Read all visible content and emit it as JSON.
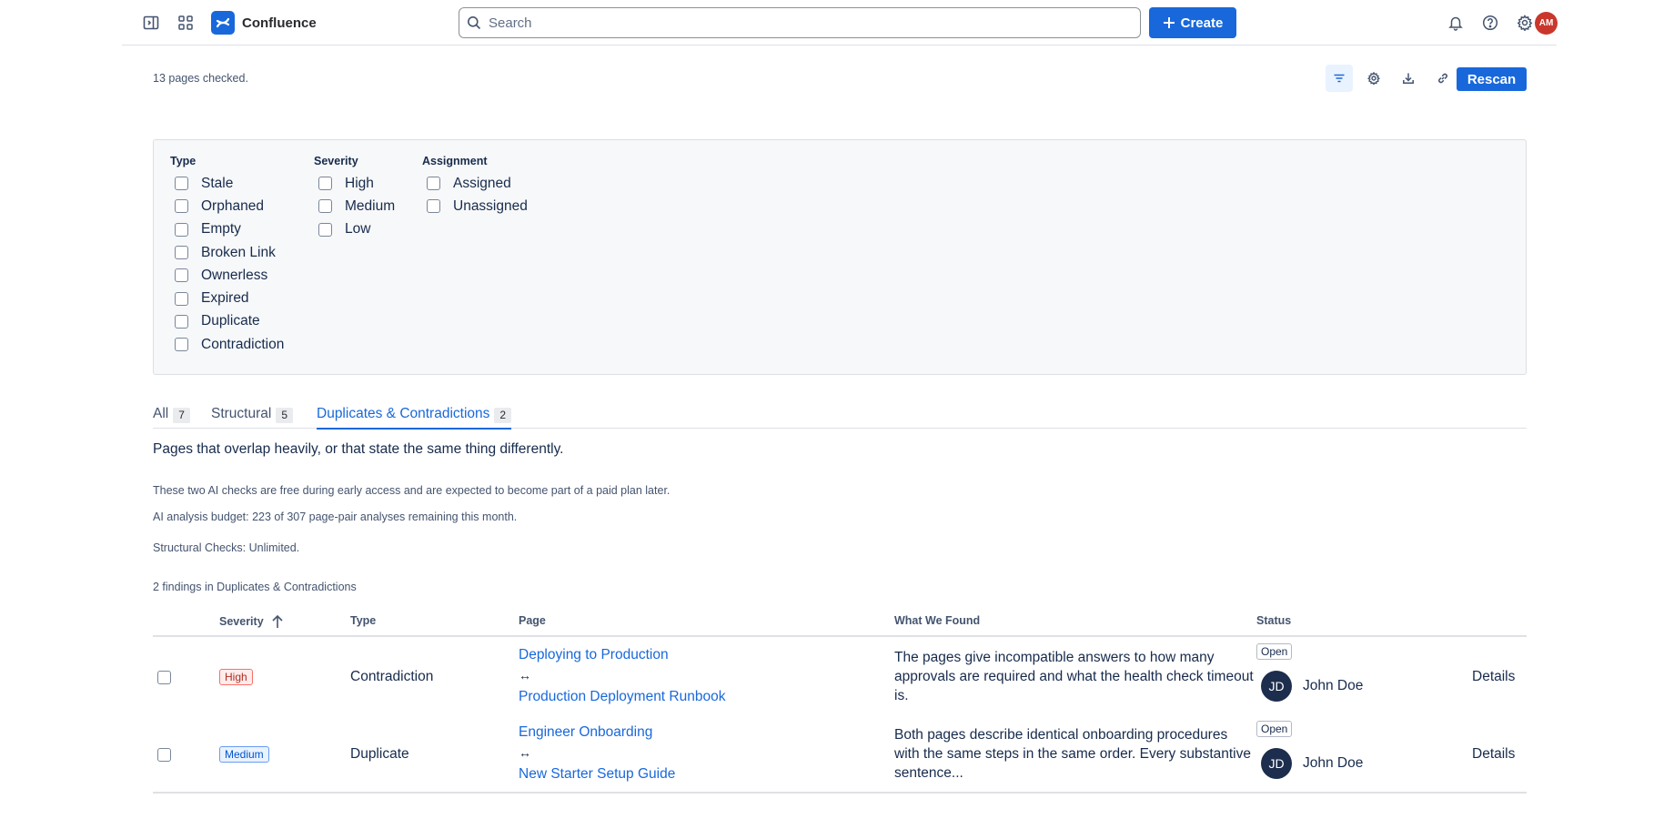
{
  "nav": {
    "app_name": "Confluence",
    "search_placeholder": "Search",
    "create_label": "Create",
    "user_initials": "AM",
    "brand_color": "#1868db",
    "icons": [
      "sidebar-toggle-icon",
      "app-switcher-icon",
      "bell-icon",
      "help-icon",
      "gear-icon"
    ]
  },
  "summary": {
    "pages_checked": "13 pages checked.",
    "rescan_label": "Rescan",
    "tool_icons": [
      "filter-icon",
      "settings-icon",
      "download-icon",
      "link-icon"
    ]
  },
  "filters": {
    "type": {
      "title": "Type",
      "options": [
        "Stale",
        "Orphaned",
        "Empty",
        "Broken Link",
        "Ownerless",
        "Expired",
        "Duplicate",
        "Contradiction"
      ]
    },
    "severity": {
      "title": "Severity",
      "options": [
        "High",
        "Medium",
        "Low"
      ]
    },
    "assignment": {
      "title": "Assignment",
      "options": [
        "Assigned",
        "Unassigned"
      ]
    }
  },
  "tabs": [
    {
      "label": "All",
      "count": "7",
      "active": false
    },
    {
      "label": "Structural",
      "count": "5",
      "active": false
    },
    {
      "label": "Duplicates & Contradictions",
      "count": "2",
      "active": true
    }
  ],
  "content": {
    "description": "Pages that overlap heavily, or that state the same thing differently.",
    "note_early_access": "These two AI checks are free during early access and are expected to become part of a paid plan later.",
    "note_budget": "AI analysis budget: 223 of 307 page-pair analyses remaining this month.",
    "note_structural": "Structural Checks: Unlimited.",
    "findings_count": "2 findings in Duplicates & Contradictions"
  },
  "table": {
    "headers": {
      "severity": "Severity",
      "type": "Type",
      "page": "Page",
      "found": "What We Found",
      "status": "Status"
    },
    "rows": [
      {
        "severity": "High",
        "type": "Contradiction",
        "page_a": "Deploying to Production",
        "arrow": "↔",
        "page_b": "Production Deployment Runbook",
        "found": "The pages give incompatible answers to how many approvals are required and what the health check timeout is.",
        "status": "Open",
        "assignee_initials": "JD",
        "assignee": "John Doe",
        "action": "Details"
      },
      {
        "severity": "Medium",
        "type": "Duplicate",
        "page_a": "Engineer Onboarding",
        "arrow": "↔",
        "page_b": "New Starter Setup Guide",
        "found": "Both pages describe identical onboarding procedures with the same steps in the same order. Every substantive sentence...",
        "status": "Open",
        "assignee_initials": "JD",
        "assignee": "John Doe",
        "action": "Details"
      }
    ]
  }
}
